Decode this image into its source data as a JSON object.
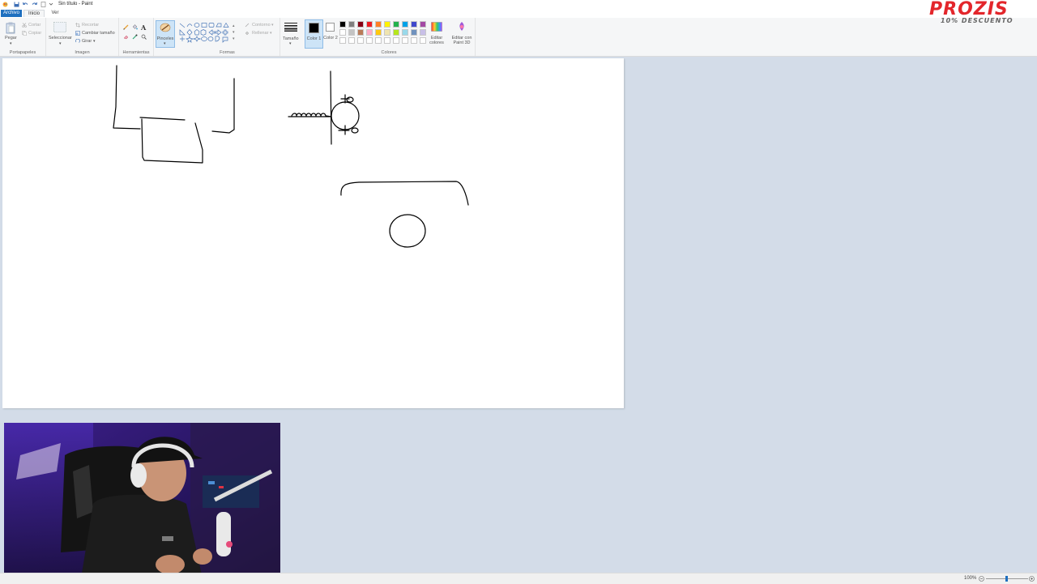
{
  "window": {
    "title": "Sin título - Paint"
  },
  "tabs": {
    "file": "Archivo",
    "home": "Inicio",
    "view": "Ver"
  },
  "clipboard": {
    "paste": "Pegar",
    "cut": "Cortar",
    "copy": "Copiar",
    "label": "Portapapeles"
  },
  "image": {
    "select": "Seleccionar",
    "crop": "Recortar",
    "resize": "Cambiar tamaño",
    "rotate": "Girar",
    "label": "Imagen"
  },
  "tools": {
    "label": "Herramientas",
    "brushes": "Pinceles"
  },
  "shapes": {
    "outline": "Contorno",
    "fill": "Rellenar",
    "label": "Formas"
  },
  "size": {
    "label": "Tamaño"
  },
  "colors": {
    "color1": "Color 1",
    "color2": "Color 2",
    "edit": "Editar colores",
    "label": "Colores",
    "edit_paint3d": "Editar con Paint 3D",
    "color1_value": "#000000",
    "color2_value": "#ffffff",
    "palette_row1": [
      "#000000",
      "#7f7f7f",
      "#880015",
      "#ed1c24",
      "#ff7f27",
      "#fff200",
      "#22b14c",
      "#00a2e8",
      "#3f48cc",
      "#a349a4"
    ],
    "palette_row2": [
      "#ffffff",
      "#c3c3c3",
      "#b97a57",
      "#ffaec9",
      "#ffc90e",
      "#efe4b0",
      "#b5e61d",
      "#99d9ea",
      "#7092be",
      "#c8bfe7"
    ]
  },
  "status": {
    "zoom": "100%"
  },
  "promo": {
    "logo": "PROZIS",
    "discount": "10% DESCUENTO"
  }
}
